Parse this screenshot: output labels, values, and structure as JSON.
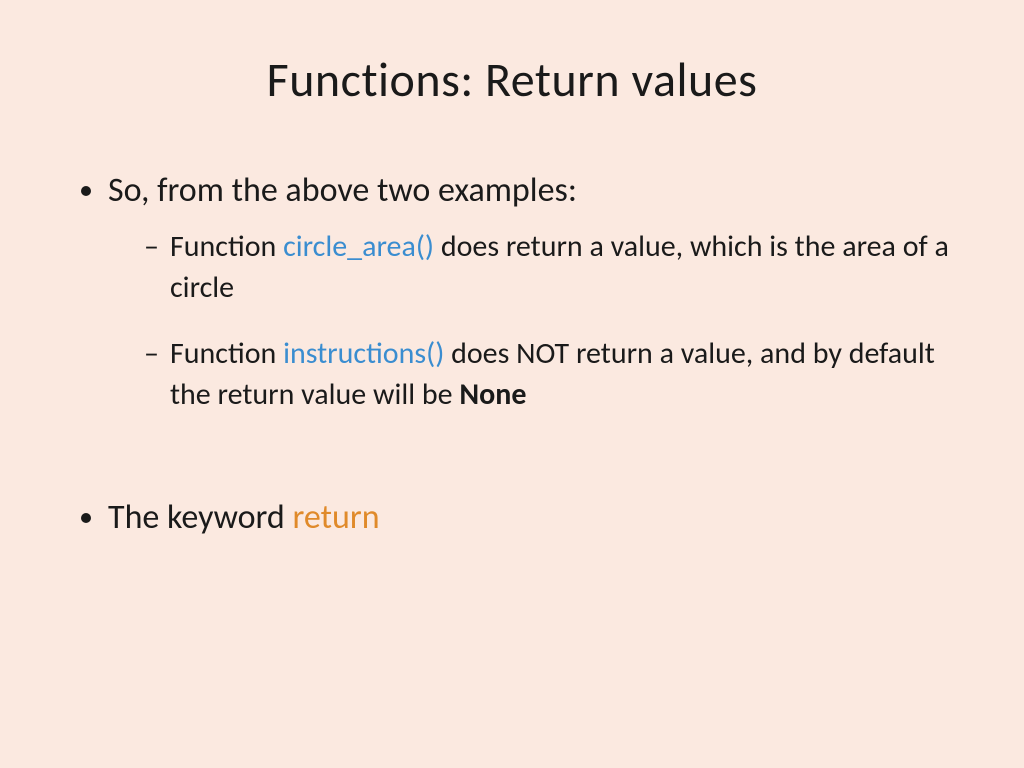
{
  "slide": {
    "title": "Functions: Return values",
    "bullet1": {
      "intro": "So, from the above two examples:",
      "sub1": {
        "prefix": "Function ",
        "code": "circle_area()",
        "suffix": " does return a value, which is the area of a circle"
      },
      "sub2": {
        "prefix": "Function ",
        "code": "instructions()",
        "mid": " does NOT return a value, and by default the return value will be ",
        "bold": "None"
      }
    },
    "bullet2": {
      "prefix": "The keyword ",
      "code": "return"
    }
  }
}
